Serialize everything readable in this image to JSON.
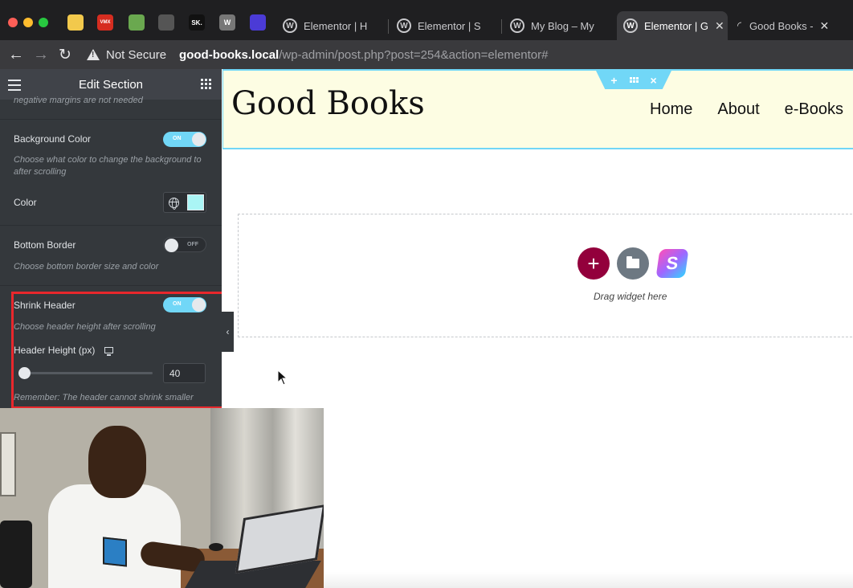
{
  "browser": {
    "pinned_icons": [
      {
        "name": "hatch-icon",
        "color": "#f2c94c",
        "text": ""
      },
      {
        "name": "vmix-icon",
        "color": "#d62d20",
        "text": "VMX"
      },
      {
        "name": "leaf-icon",
        "color": "#6aa84f",
        "text": ""
      },
      {
        "name": "ghost-icon",
        "color": "#555555",
        "text": ""
      },
      {
        "name": "skillshare-icon",
        "color": "#111111",
        "text": "SK."
      },
      {
        "name": "wordpress-icon",
        "color": "#777777",
        "text": "W"
      },
      {
        "name": "loader-icon",
        "color": "#4b3bd6",
        "text": ""
      }
    ],
    "tabs": [
      {
        "label": "Elementor | H",
        "active": false
      },
      {
        "label": "Elementor | S",
        "active": false
      },
      {
        "label": "My Blog – My",
        "active": false
      },
      {
        "label": "Elementor | G",
        "active": true
      },
      {
        "label": "Good Books -",
        "active": false
      }
    ],
    "url_security": "Not Secure",
    "url_host": "good-books.local",
    "url_path": "/wp-admin/post.php?post=254&action=elementor#"
  },
  "panel": {
    "title": "Edit Section",
    "truncated_note": "negative margins are not needed",
    "background_color": {
      "label": "Background Color",
      "switch": "ON",
      "description": "Choose what color to change the background to after scrolling"
    },
    "color": {
      "label": "Color",
      "swatch": "#aaf5f5"
    },
    "bottom_border": {
      "label": "Bottom Border",
      "switch": "OFF",
      "description": "Choose bottom border size and color"
    },
    "shrink_header": {
      "label": "Shrink Header",
      "switch": "ON",
      "description": "Choose header height after scrolling"
    },
    "header_height": {
      "label": "Header Height (px)",
      "value": "40",
      "slider_fraction": 0.0
    },
    "remember": "Remember: The header cannot shrink smaller"
  },
  "preview": {
    "site_title": "Good Books",
    "nav": [
      "Home",
      "About",
      "e-Books"
    ],
    "handle": {
      "add": "+",
      "close": "×"
    },
    "add_button": "+",
    "s_logo": "S",
    "drop_text": "Drag widget here"
  },
  "colors": {
    "accent": "#71d7f7",
    "header_bg": "#fdfde3",
    "highlight": "#e8272c",
    "add_button": "#93003c"
  }
}
